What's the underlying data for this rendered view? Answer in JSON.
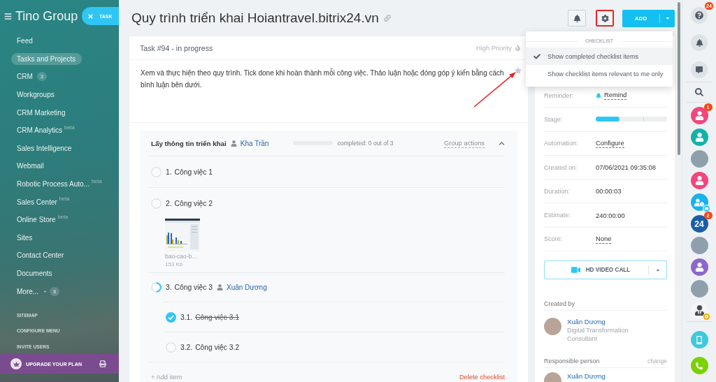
{
  "sidebar": {
    "logo": "Tino Group",
    "task_button": "TASK",
    "items": [
      {
        "label": "Feed",
        "selected": false
      },
      {
        "label": "Tasks and Projects",
        "selected": true
      },
      {
        "label": "CRM",
        "selected": false,
        "counter": "3"
      },
      {
        "label": "Workgroups",
        "selected": false
      },
      {
        "label": "CRM Marketing",
        "selected": false
      },
      {
        "label": "CRM Analytics",
        "selected": false,
        "tag": "beta"
      },
      {
        "label": "Sales Intelligence",
        "selected": false
      },
      {
        "label": "Webmail",
        "selected": false
      },
      {
        "label": "Robotic Process Auto...",
        "selected": false,
        "tag": "beta"
      },
      {
        "label": "Sales Center",
        "selected": false,
        "tag": "beta"
      },
      {
        "label": "Online Store",
        "selected": false,
        "tag": "beta"
      },
      {
        "label": "Sites",
        "selected": false
      },
      {
        "label": "Contact Center",
        "selected": false
      },
      {
        "label": "Documents",
        "selected": false
      }
    ],
    "more": {
      "label": "More...",
      "counter": "6"
    },
    "links": [
      "SITEMAP",
      "CONFIGURE MENU",
      "INVITE USERS"
    ],
    "upgrade": "UPGRADE YOUR PLAN"
  },
  "header": {
    "title": "Quy trình triển khai Hoiantravel.bitrix24.vn",
    "settings_highlighted": true,
    "add_button": "ADD"
  },
  "checklist_menu": {
    "title": "CHECKLIST",
    "options": [
      {
        "label": "Show completed checklist items",
        "checked": true,
        "hovered": true
      },
      {
        "label": "Show checklist items relevant to me only",
        "checked": false,
        "hovered": false
      }
    ]
  },
  "task": {
    "heading": "Task #94 - in progress",
    "priority": "High Priority",
    "description": "Xem và thực hiện theo quy trình. Tick done khi hoàn thành mỗi công việc. Thảo luận hoặc đóng góp ý kiến bằng cách bình luận bên dưới.",
    "favorite": false,
    "checklist": {
      "title": "Lấy thông tin triển khai",
      "assignee": "Kha Trần",
      "level": 0,
      "progress": "completed: 0 out of 3",
      "group_actions": "Group actions",
      "expanded": true,
      "items": [
        {
          "number": "1.",
          "title": "Công việc 1",
          "checked": false
        },
        {
          "number": "2.",
          "title": "Công việc 2",
          "checked": false,
          "attachments": [
            {
              "name": "bao-cao-b...",
              "size": "153 Kb"
            }
          ]
        },
        {
          "number": "3.",
          "title": "Công việc 3",
          "checked": false,
          "level": 0.5,
          "assignee": "Xuân Dương",
          "children": [
            {
              "number": "3.1.",
              "title": "Công việc 3.1",
              "checked": true
            },
            {
              "number": "3.2.",
              "title": "Công việc 3.2",
              "checked": false
            }
          ]
        }
      ],
      "add_item": "+ Add item",
      "delete": "Delete checklist"
    }
  },
  "details": {
    "fields": [
      {
        "kind": "reminder",
        "label": "Reminder:",
        "value": "Remind"
      },
      {
        "kind": "stage",
        "label": "Stage:",
        "level": 0.33
      },
      {
        "kind": "link",
        "label": "Automation:",
        "value": "Configure"
      },
      {
        "kind": "text",
        "label": "Created on:",
        "value": "07/06/2021 09:35:08"
      },
      {
        "kind": "text",
        "label": "Duration:",
        "value": "00:00:03"
      },
      {
        "kind": "text",
        "label": "Estimate:",
        "value": "240:00:00"
      },
      {
        "kind": "link",
        "label": "Score:",
        "value": "None"
      }
    ],
    "video_call": "HD VIDEO CALL",
    "created_by": {
      "title": "Created by",
      "name": "Xuân Dương",
      "position": "Digital Transformation Consultant"
    },
    "responsible": {
      "title": "Responsible person",
      "action": "change",
      "name": "Xuân Dương"
    }
  },
  "right_bar": {
    "tools": [
      {
        "kind": "help",
        "badge": "24"
      },
      {
        "kind": "notifications"
      },
      {
        "kind": "messages"
      },
      {
        "kind": "search"
      }
    ],
    "contacts": [
      {
        "kind": "user",
        "color": "#f4467c",
        "badge": "1",
        "has_mail": false,
        "away": false
      },
      {
        "kind": "user",
        "color": "#12b3a6",
        "has_mail": false,
        "away": false
      },
      {
        "kind": "photo",
        "has_mail": false,
        "away": false
      },
      {
        "kind": "user",
        "color": "#f4467c",
        "has_mail": false,
        "away": false
      },
      {
        "kind": "user-clock",
        "color": "#1ab1ec",
        "has_mail": true,
        "away": false
      },
      {
        "kind": "logo",
        "text": "24",
        "color": "#1b5ea8",
        "badge": "2",
        "has_mail": false,
        "away": false
      },
      {
        "kind": "photo",
        "has_mail": false,
        "away": false
      },
      {
        "kind": "user",
        "color": "#8c68cd",
        "has_mail": false,
        "away": false
      },
      {
        "kind": "photo",
        "has_mail": false,
        "away": false
      },
      {
        "kind": "silhouette",
        "has_mail": false,
        "away": true
      }
    ],
    "actions": [
      {
        "kind": "mobile"
      },
      {
        "kind": "call"
      }
    ]
  }
}
